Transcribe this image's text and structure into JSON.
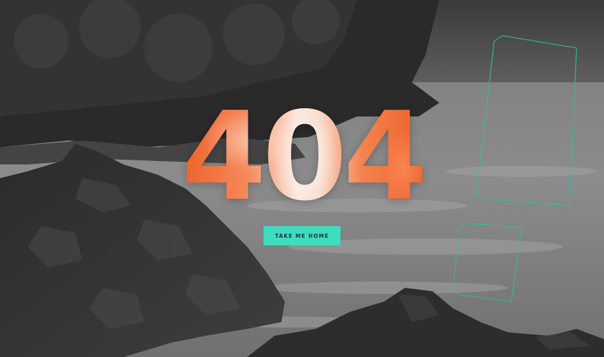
{
  "error": {
    "code": "404"
  },
  "home_button": {
    "label": "TAKE ME HOME"
  },
  "colors": {
    "accent_teal": "#3fdcc0",
    "error_orange": "#f06a35",
    "outline_teal": "#2fbfa4"
  }
}
